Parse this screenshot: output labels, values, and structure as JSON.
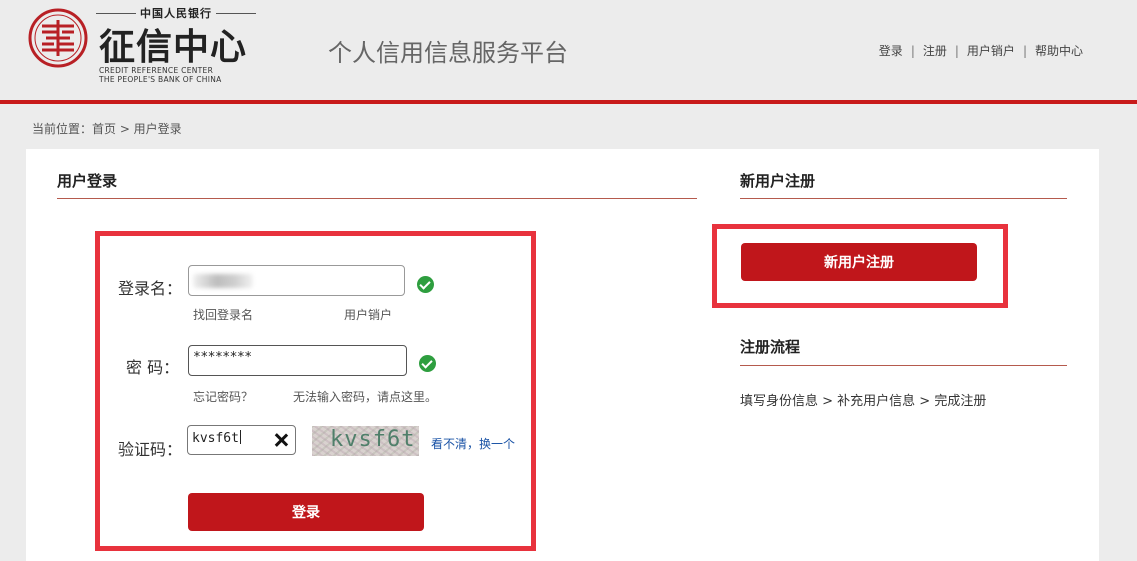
{
  "header": {
    "logo_top": "中国人民银行",
    "logo_main": "征信中心",
    "logo_en_line1": "CREDIT REFERENCE CENTER",
    "logo_en_line2": "THE PEOPLE'S BANK OF CHINA",
    "platform_title": "个人信用信息服务平台",
    "nav": {
      "login": "登录",
      "register": "注册",
      "cancel_account": "用户销户",
      "help": "帮助中心",
      "separator": "|"
    }
  },
  "breadcrumb": "当前位置：首页 > 用户登录",
  "login": {
    "title": "用户登录",
    "username_label": "登录名：",
    "password_label": "密  码：",
    "password_value": "********",
    "captcha_label": "验证码：",
    "captcha_value": "kvsf6t",
    "captcha_image_text": "kvsf6t",
    "refresh_link": "看不清，换一个",
    "find_username_link": "找回登录名",
    "cancel_account_link": "用户销户",
    "forgot_password_link": "忘记密码？",
    "cannot_input_link": "无法输入密码，请点这里。",
    "submit_label": "登录"
  },
  "register": {
    "title": "新用户注册",
    "button_label": "新用户注册",
    "flow_title": "注册流程",
    "flow_text": "填写身份信息 > 补充用户信息 > 完成注册"
  },
  "colors": {
    "brand_red": "#c0161b",
    "highlight_red": "#e8323d",
    "valid_green": "#2e9e3f"
  }
}
